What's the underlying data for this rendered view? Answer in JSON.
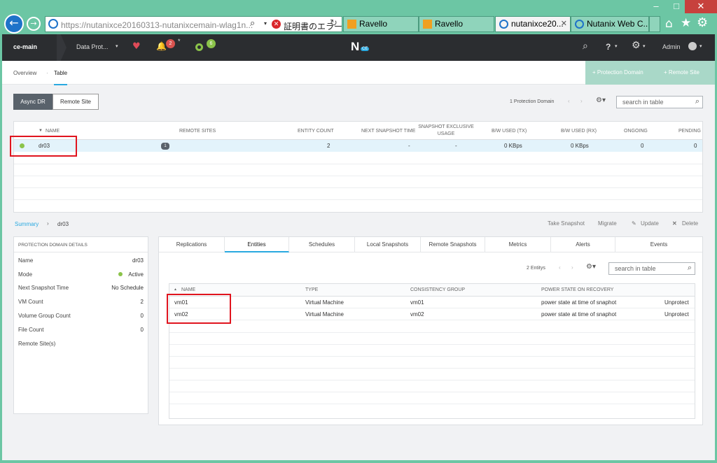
{
  "window": {
    "minimize": "–",
    "maximize": "□",
    "close": "✕"
  },
  "browser": {
    "url": "https://nutanixce20160313-nutanixcemain-wlag1n...",
    "cert_error": "証明書のエラー",
    "tabs": [
      {
        "label": "Ravello",
        "active": false
      },
      {
        "label": "Ravello",
        "active": false
      },
      {
        "label": "nutanixce20...",
        "active": true
      },
      {
        "label": "Nutanix Web C...",
        "active": false
      }
    ]
  },
  "appbar": {
    "cluster": "ce-main",
    "menu": "Data Prot...",
    "alert_count": "2",
    "alert_star": "*",
    "task_count": "6",
    "logo": "N",
    "logo_badge": "CE",
    "help": "?",
    "user": "Admin"
  },
  "subnav": {
    "overview": "Overview",
    "sep": "·",
    "table": "Table",
    "protection_domain_btn": "+ Protection Domain",
    "remote_site_btn": "+ Remote Site"
  },
  "toggles": {
    "async": "Async DR",
    "remote": "Remote Site"
  },
  "top_table": {
    "count": "1 Protection Domain",
    "search_placeholder": "search in table",
    "headers": [
      "NAME",
      "REMOTE SITES",
      "ENTITY COUNT",
      "NEXT SNAPSHOT TIME",
      "SNAPSHOT EXCLUSIVE USAGE",
      "B/W USED (TX)",
      "B/W USED (RX)",
      "ONGOING",
      "PENDING"
    ],
    "row": {
      "name": "dr03",
      "badge": "1",
      "entity_count": "2",
      "next_snapshot": "-",
      "exclusive": "-",
      "tx": "0 KBps",
      "rx": "0 KBps",
      "ongoing": "0",
      "pending": "0"
    }
  },
  "breadcrumb": {
    "summary": "Summary",
    "sep": "›",
    "current": "dr03"
  },
  "actions": {
    "take_snapshot": "Take Snapshot",
    "migrate": "Migrate",
    "update": "Update",
    "delete": "Delete"
  },
  "details": {
    "title": "PROTECTION DOMAIN DETAILS",
    "rows": [
      {
        "k": "Name",
        "v": "dr03"
      },
      {
        "k": "Mode",
        "v": "Active"
      },
      {
        "k": "Next Snapshot Time",
        "v": "No Schedule"
      },
      {
        "k": "VM Count",
        "v": "2"
      },
      {
        "k": "Volume Group Count",
        "v": "0"
      },
      {
        "k": "File Count",
        "v": "0"
      },
      {
        "k": "Remote Site(s)",
        "v": ""
      }
    ]
  },
  "subtabs": [
    "Replications",
    "Entities",
    "Schedules",
    "Local Snapshots",
    "Remote Snapshots",
    "Metrics",
    "Alerts",
    "Events"
  ],
  "entities": {
    "count": "2 Entitys",
    "search_placeholder": "search in table",
    "headers": [
      "NAME",
      "TYPE",
      "CONSISTENCY GROUP",
      "POWER STATE ON RECOVERY"
    ],
    "rows": [
      {
        "name": "vm01",
        "type": "Virtual Machine",
        "cg": "vm01",
        "power": "power state at time of snaphot",
        "action": "Unprotect"
      },
      {
        "name": "vm02",
        "type": "Virtual Machine",
        "cg": "vm02",
        "power": "power state at time of snaphot",
        "action": "Unprotect"
      }
    ]
  },
  "colors": {
    "teal_bg": "#6cc6a4",
    "dark_bar": "#2b2d30",
    "accent_blue": "#29a9e0",
    "alert_red": "#e0141e",
    "ok_green": "#8bc34a"
  }
}
